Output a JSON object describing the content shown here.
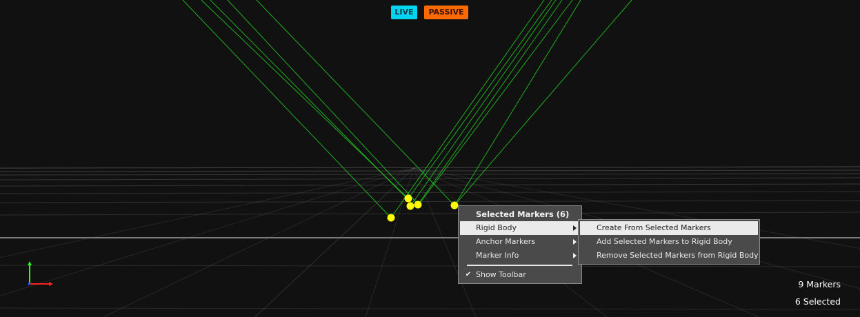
{
  "badges": {
    "live": "LIVE",
    "passive": "PASSIVE"
  },
  "context_menu": {
    "header": "Selected Markers (6)",
    "items": [
      {
        "label": "Rigid Body",
        "has_submenu": true,
        "highlighted": true
      },
      {
        "label": "Anchor Markers",
        "has_submenu": true,
        "highlighted": false
      },
      {
        "label": "Marker Info",
        "has_submenu": true,
        "highlighted": false
      }
    ],
    "toggle_item": {
      "label": "Show Toolbar",
      "checked": true,
      "check_glyph": "✔"
    }
  },
  "submenu": {
    "items": [
      {
        "label": "Create From Selected Markers",
        "highlighted": true
      },
      {
        "label": "Add Selected Markers to Rigid Body",
        "highlighted": false
      },
      {
        "label": "Remove Selected Markers from Rigid Body",
        "highlighted": false
      }
    ]
  },
  "stats": {
    "markers": "9 Markers",
    "selected": "6 Selected"
  },
  "colors": {
    "background": "#111111",
    "grid": "#777777",
    "ray": "#22cc22",
    "marker": "#ffff00",
    "axis_x": "#ff2020",
    "axis_y": "#20ff20",
    "axis_z": "#2050ff",
    "live_badge": "#00d4f0",
    "passive_badge": "#ff6a00"
  },
  "icons": {
    "axis_gizmo": "axis-triad-icon",
    "submenu_arrow": "chevron-right-icon",
    "check": "check-icon"
  }
}
